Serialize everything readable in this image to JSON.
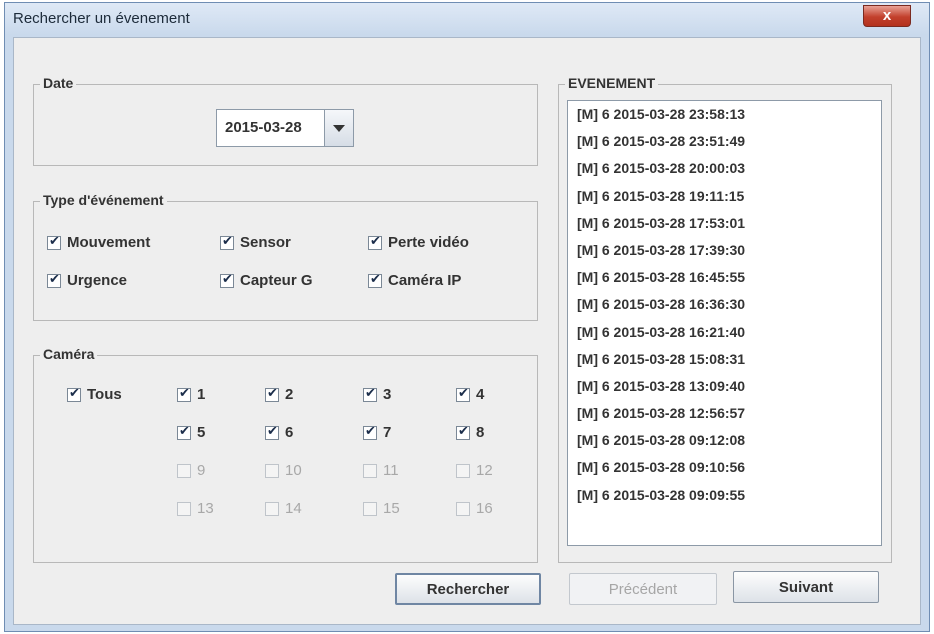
{
  "window": {
    "title": "Rechercher un évenement",
    "close_glyph": "x"
  },
  "date_group": {
    "label": "Date",
    "value": "2015-03-28"
  },
  "type_group": {
    "label": "Type d'événement",
    "items": [
      {
        "label": "Mouvement",
        "checked": true
      },
      {
        "label": "Sensor",
        "checked": true
      },
      {
        "label": "Perte vidéo",
        "checked": true
      },
      {
        "label": "Urgence",
        "checked": true
      },
      {
        "label": "Capteur G",
        "checked": true
      },
      {
        "label": "Caméra IP",
        "checked": true
      }
    ]
  },
  "camera_group": {
    "label": "Caméra",
    "all": {
      "label": "Tous",
      "checked": true
    },
    "cameras": [
      {
        "label": "1",
        "checked": true,
        "enabled": true
      },
      {
        "label": "2",
        "checked": true,
        "enabled": true
      },
      {
        "label": "3",
        "checked": true,
        "enabled": true
      },
      {
        "label": "4",
        "checked": true,
        "enabled": true
      },
      {
        "label": "5",
        "checked": true,
        "enabled": true
      },
      {
        "label": "6",
        "checked": true,
        "enabled": true
      },
      {
        "label": "7",
        "checked": true,
        "enabled": true
      },
      {
        "label": "8",
        "checked": true,
        "enabled": true
      },
      {
        "label": "9",
        "checked": false,
        "enabled": false
      },
      {
        "label": "10",
        "checked": false,
        "enabled": false
      },
      {
        "label": "11",
        "checked": false,
        "enabled": false
      },
      {
        "label": "12",
        "checked": false,
        "enabled": false
      },
      {
        "label": "13",
        "checked": false,
        "enabled": false
      },
      {
        "label": "14",
        "checked": false,
        "enabled": false
      },
      {
        "label": "15",
        "checked": false,
        "enabled": false
      },
      {
        "label": "16",
        "checked": false,
        "enabled": false
      }
    ]
  },
  "events_group": {
    "label": "EVENEMENT",
    "items": [
      "[M] 6 2015-03-28 23:58:13",
      "[M] 6 2015-03-28 23:51:49",
      "[M] 6 2015-03-28 20:00:03",
      "[M] 6 2015-03-28 19:11:15",
      "[M] 6 2015-03-28 17:53:01",
      "[M] 6 2015-03-28 17:39:30",
      "[M] 6 2015-03-28 16:45:55",
      "[M] 6 2015-03-28 16:36:30",
      "[M] 6 2015-03-28 16:21:40",
      "[M] 6 2015-03-28 15:08:31",
      "[M] 6 2015-03-28 13:09:40",
      "[M] 6 2015-03-28 12:56:57",
      "[M] 6 2015-03-28 09:12:08",
      "[M] 6 2015-03-28 09:10:56",
      "[M] 6 2015-03-28 09:09:55"
    ]
  },
  "buttons": {
    "search": "Rechercher",
    "previous": "Précédent",
    "next": "Suivant",
    "previous_enabled": false
  }
}
